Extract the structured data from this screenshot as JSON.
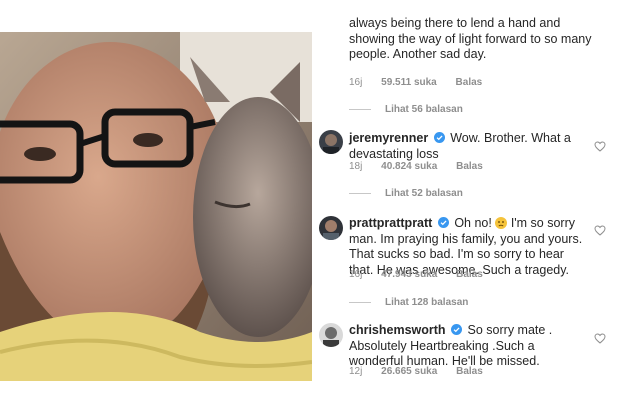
{
  "comments": {
    "top": {
      "text": "always being there to lend a hand and showing the way of light forward to so many people. Another sad day.",
      "time": "16j",
      "likes": "59.511 suka",
      "reply": "Balas",
      "view_replies": "Lihat 56 balasan"
    },
    "c1": {
      "username": "jeremyrenner",
      "text": "Wow.  Brother.  What a devastating loss",
      "time": "18j",
      "likes": "40.824 suka",
      "reply": "Balas",
      "view_replies": "Lihat 52 balasan"
    },
    "c2": {
      "username": "prattprattpratt",
      "text_before": "Oh no!",
      "text_after": "I'm so sorry man. Im praying his family, you and yours. That sucks so bad. I'm so sorry to hear that. He was awesome. Such a tragedy.",
      "emoji": "sad-face-emoji",
      "time": "16j",
      "likes": "47.943 suka",
      "reply": "Balas",
      "view_replies": "Lihat 128 balasan"
    },
    "c3": {
      "username": "chrishemsworth",
      "text": "So sorry mate . Absolutely Heartbreaking .Such a wonderful human. He'll be missed.",
      "time": "12j",
      "likes": "26.665 suka",
      "reply": "Balas"
    }
  },
  "colors": {
    "verified": "#3897f0",
    "meta_text": "#8e8e8e",
    "text": "#262626"
  },
  "icons": [
    "verified-badge-icon",
    "heart-outline-icon",
    "avatar"
  ]
}
